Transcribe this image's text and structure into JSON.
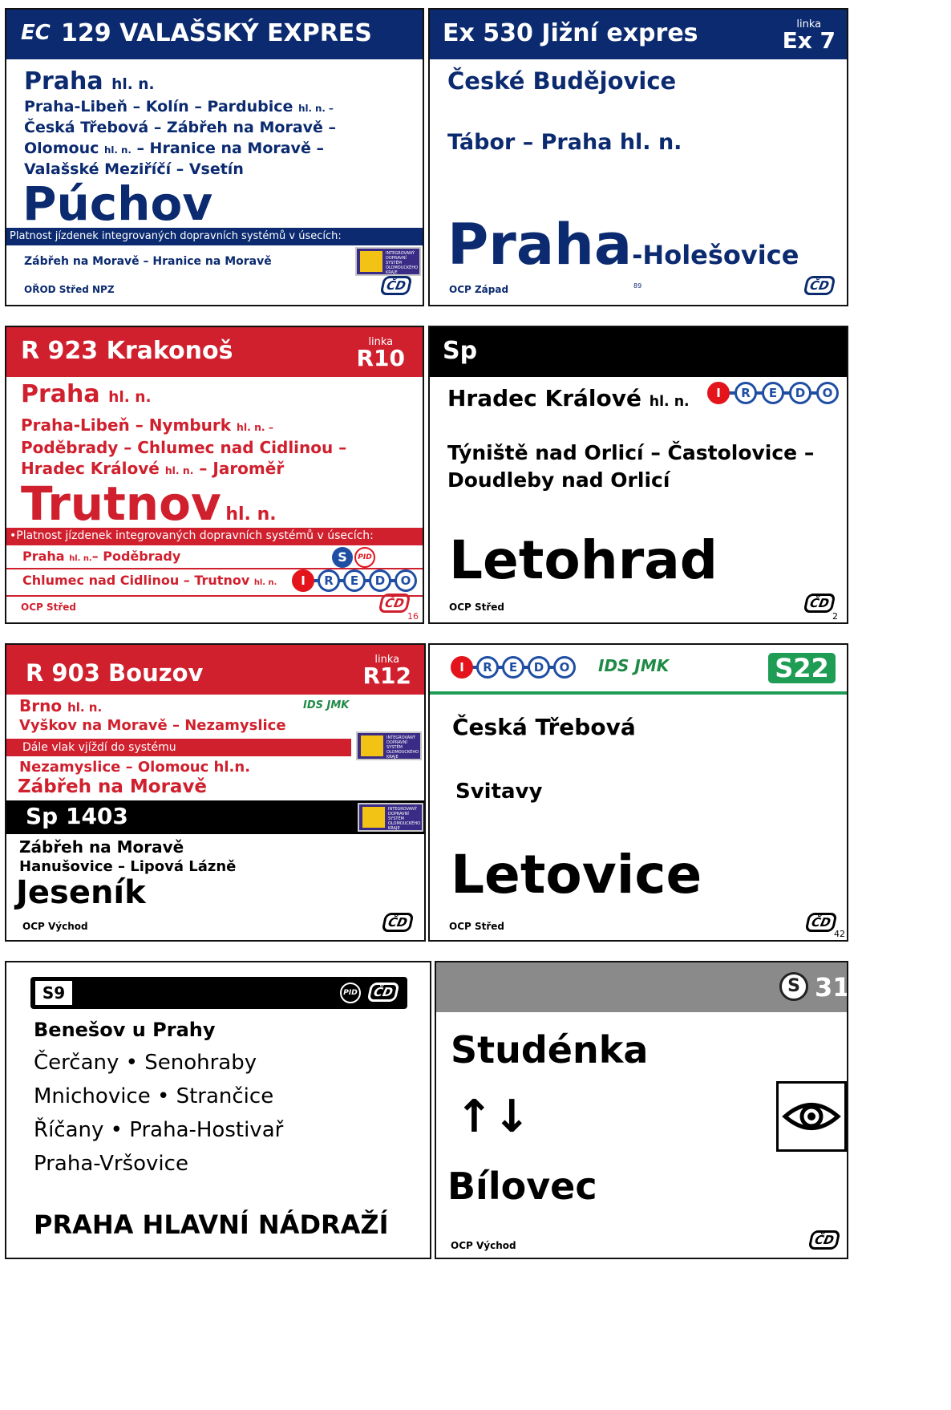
{
  "colors": {
    "navy": "#0b2a6f",
    "red": "#d0202e",
    "black": "#000000",
    "green": "#1f9d55",
    "gray": "#8a8a8a",
    "purple": "#3a2c86",
    "yellow": "#f2c315"
  },
  "board1": {
    "type": "EC",
    "title": "129  VALAŠSKÝ EXPRES",
    "origin": "Praha",
    "origin_suffix": "hl. n.",
    "via1": "Praha-Libeň – Kolín – Pardubice",
    "via1_suffix": "hl. n. –",
    "via2": "Česká Třebová – Zábřeh na Moravě –",
    "via3": "Olomouc",
    "via3_suffix": "hl. n.",
    "via3_rest": "– Hranice na Moravě –",
    "via4": "Valašské Meziříčí – Vsetín",
    "destination": "Púchov",
    "band": "Platnost jízdenek integrovaných dopravních systémů v úsecích:",
    "section": "Zábřeh na Moravě – Hranice na Moravě",
    "footer": "OŘOD Střed NPZ",
    "ids_text": "INTEGROVANÝ DOPRAVNÍ SYSTÉM OLOMOUCKÉHO KRAJE"
  },
  "board2": {
    "title": "Ex 530  Jižní expres",
    "linka_label": "linka",
    "linka_value": "Ex 7",
    "origin": "České Budějovice",
    "via": "Tábor – Praha hl. n.",
    "destination": "Praha",
    "destination_suffix": "-Holešovice",
    "footer": "OCP Západ",
    "page": "89"
  },
  "board3": {
    "title": "R 923  Krakonoš",
    "linka_label": "linka",
    "linka_value": "R10",
    "origin": "Praha",
    "origin_suffix": "hl. n.",
    "via1": "Praha-Libeň – Nymburk",
    "via1_suffix": "hl. n. –",
    "via2": "Poděbrady – Chlumec nad Cidlinou –",
    "via3": "Hradec Králové",
    "via3_suffix": "hl. n.",
    "via3_rest": " –  Jaroměř",
    "destination": "Trutnov",
    "destination_suffix": "hl. n.",
    "band": "•Platnost jízdenek integrovaných dopravních systémů v úsecích:",
    "section1": "Praha",
    "section1_suffix": "hl. n.",
    "section1_rest": "– Poděbrady",
    "section2": "Chlumec nad Cidlinou – Trutnov",
    "section2_suffix": "hl. n.",
    "footer": "OCP Střed",
    "page": "16",
    "s_label": "S",
    "pid_label": "PID"
  },
  "board4": {
    "title": "Sp",
    "origin": "Hradec Králové",
    "origin_suffix": "hl. n.",
    "via1": "Týniště nad Orlicí – Častolovice –",
    "via2": "Doudleby nad Orlicí",
    "destination": "Letohrad",
    "footer": "OCP Střed",
    "page": "2",
    "iredo": [
      "I",
      "R",
      "E",
      "D",
      "O"
    ]
  },
  "board5": {
    "title": "R 903  Bouzov",
    "linka_label": "linka",
    "linka_value": "R12",
    "origin": "Brno",
    "origin_suffix": "hl. n.",
    "via1": "Vyškov na Moravě – Nezamyslice",
    "band": "Dále vlak vjíždí do systému",
    "via2": "Nezamyslice – Olomouc hl.n.",
    "destination1": "Zábřeh na Moravě",
    "train2": "Sp 1403",
    "origin2": "Zábřeh na Moravě",
    "via3": "Hanušovice – Lipová Lázně",
    "destination2": "Jeseník",
    "footer": "OCP Východ",
    "ids_jmk": "IDS JMK"
  },
  "board6": {
    "line": "S22",
    "ids_jmk": "IDS JMK",
    "origin": "Česká Třebová",
    "via": "Svitavy",
    "destination": "Letovice",
    "footer": "OCP Střed",
    "page": "42"
  },
  "board7": {
    "line": "S9",
    "origin": "Benešov u Prahy",
    "via1": "Čerčany • Senohraby",
    "via2": "Mnichovice • Strančice",
    "via3": "Říčany • Praha-Hostivař",
    "via4": "Praha-Vršovice",
    "destination": "PRAHA HLAVNÍ NÁDRAŽÍ",
    "pid_label": "PID"
  },
  "board8": {
    "line_icon": "S",
    "line": "31",
    "origin": "Studénka",
    "arrows": "↑↓",
    "destination": "Bílovec",
    "footer": "OCP Východ"
  },
  "cd_logo": "ČD"
}
